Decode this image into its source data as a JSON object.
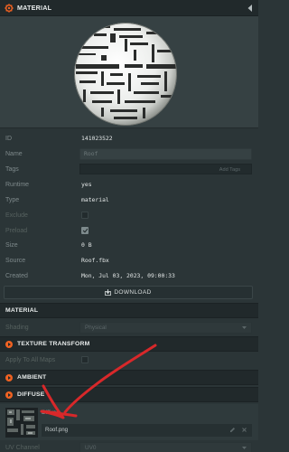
{
  "header": {
    "title": "MATERIAL"
  },
  "properties": {
    "id": {
      "label": "ID",
      "value": "141023522"
    },
    "name": {
      "label": "Name",
      "value": "Roof"
    },
    "tags": {
      "label": "Tags",
      "add_label": "Add Tags"
    },
    "runtime": {
      "label": "Runtime",
      "value": "yes"
    },
    "type": {
      "label": "Type",
      "value": "material"
    },
    "exclude": {
      "label": "Exclude",
      "checked": false
    },
    "preload": {
      "label": "Preload",
      "checked": true
    },
    "size": {
      "label": "Size",
      "value": "0 B"
    },
    "source": {
      "label": "Source",
      "value": "Roof.fbx"
    },
    "created": {
      "label": "Created",
      "value": "Mon, Jul 03, 2023, 09:00:33"
    }
  },
  "download": {
    "label": "DOWNLOAD"
  },
  "material_section": {
    "title": "MATERIAL",
    "shading_label": "Shading",
    "shading_value": "Physical"
  },
  "texture_transform": {
    "title": "TEXTURE TRANSFORM",
    "apply_label": "Apply To All Maps"
  },
  "ambient": {
    "title": "AMBIENT"
  },
  "diffuse": {
    "title": "DIFFUSE",
    "slot_name": "Diffuse",
    "file_name": "Roof.png"
  },
  "uv": {
    "label": "UV Channel",
    "value": "UV0"
  },
  "colors": {
    "accent": "#f06222",
    "panel_bg": "#2b3537",
    "header_bg": "#21292b",
    "annotation": "#d8282a"
  }
}
